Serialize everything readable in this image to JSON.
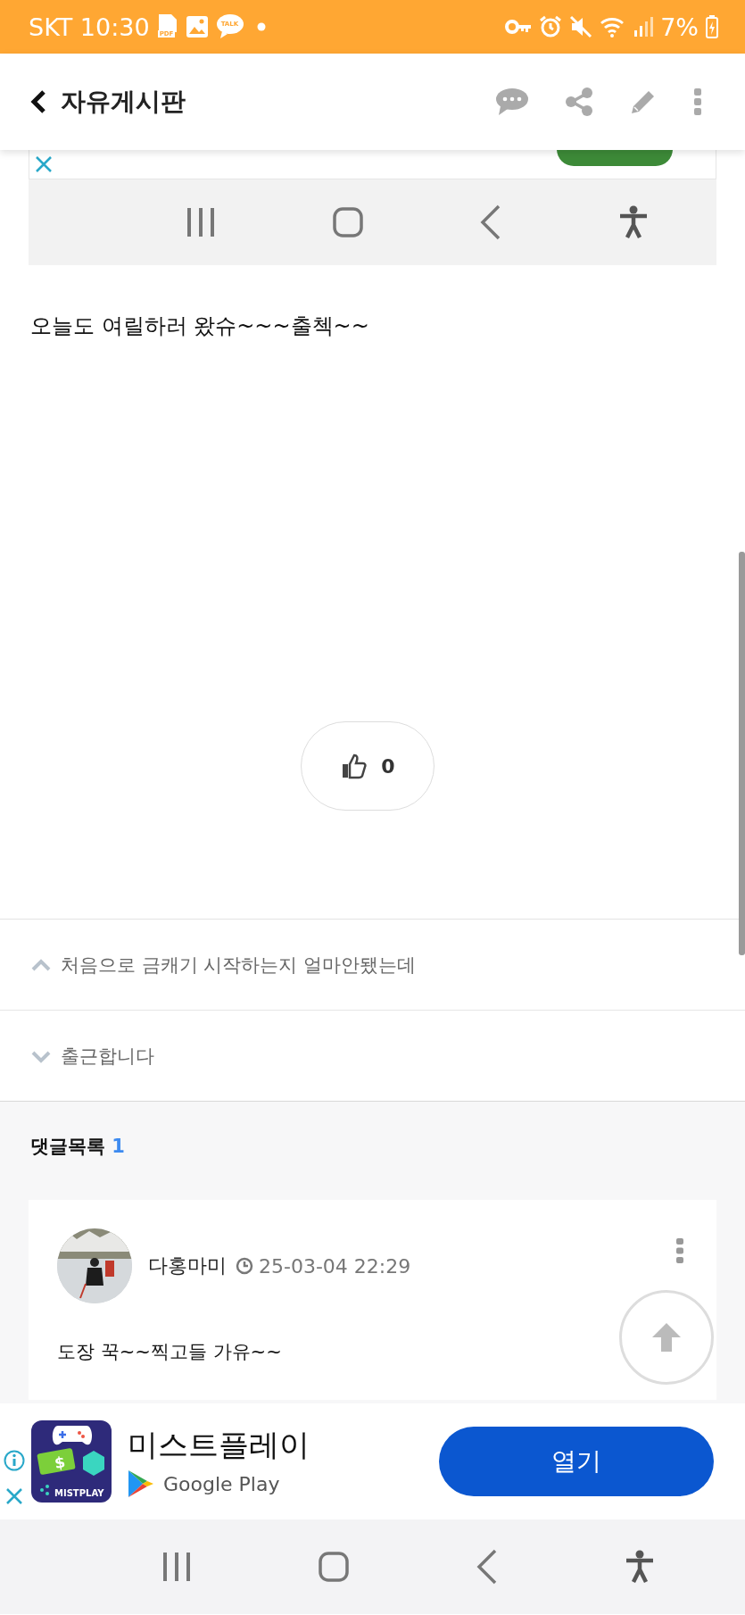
{
  "status_bar": {
    "carrier_time": "SKT 10:30",
    "pdf_label": "PDF",
    "talk_label": "TALK",
    "battery": "7%"
  },
  "header": {
    "title": "자유게시판"
  },
  "post": {
    "body": "오늘도 여릴하러 왔슈~~~출첵~~",
    "like_count": "0"
  },
  "post_navigation": [
    {
      "kind": "previous",
      "title": "처음으로 금캐기 시작하는지 얼마안됐는데"
    },
    {
      "kind": "next",
      "title": "출근합니다"
    }
  ],
  "comments": {
    "heading": "댓글목록",
    "count": "1",
    "items": [
      {
        "author": "다홍마미",
        "time": "25-03-04 22:29",
        "text": "도장 꾹~~찍고들 가유~~"
      }
    ]
  },
  "ad": {
    "app_name": "미스트플레이",
    "store": "Google Play",
    "icon_symbol": "$",
    "icon_label": "MISTPLAY",
    "button": "열기"
  }
}
